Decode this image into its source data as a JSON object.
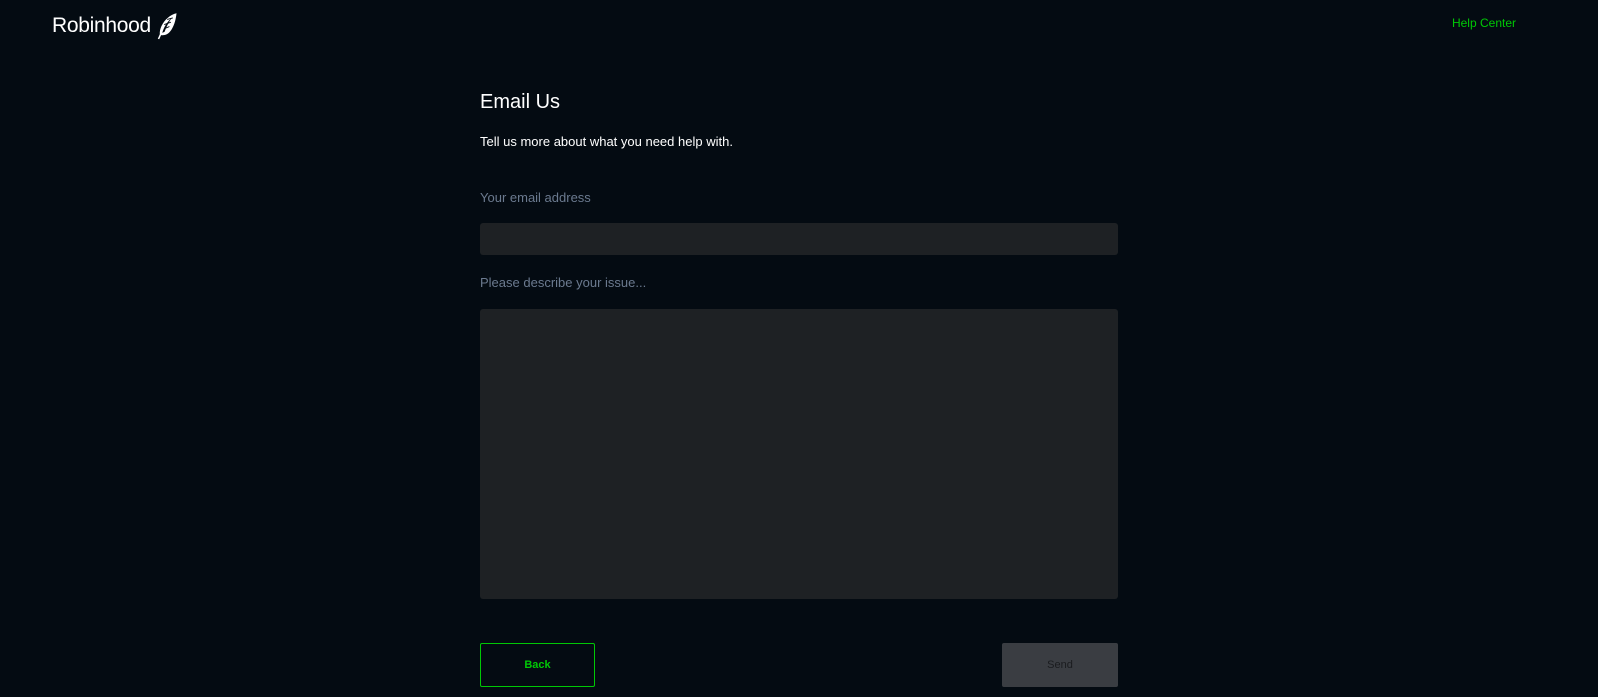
{
  "header": {
    "logo_text": "Robinhood",
    "logo_icon": "feather-icon",
    "help_center_label": "Help Center"
  },
  "form": {
    "title": "Email Us",
    "subtitle": "Tell us more about what you need help with.",
    "email_label": "Your email address",
    "email_value": "",
    "issue_label": "Please describe your issue...",
    "issue_value": "",
    "back_label": "Back",
    "send_label": "Send"
  },
  "colors": {
    "background": "#040b12",
    "accent": "#00c805",
    "field_background": "#1e2124",
    "label_muted": "#6b7a8f",
    "send_disabled": "#3a3d42"
  }
}
